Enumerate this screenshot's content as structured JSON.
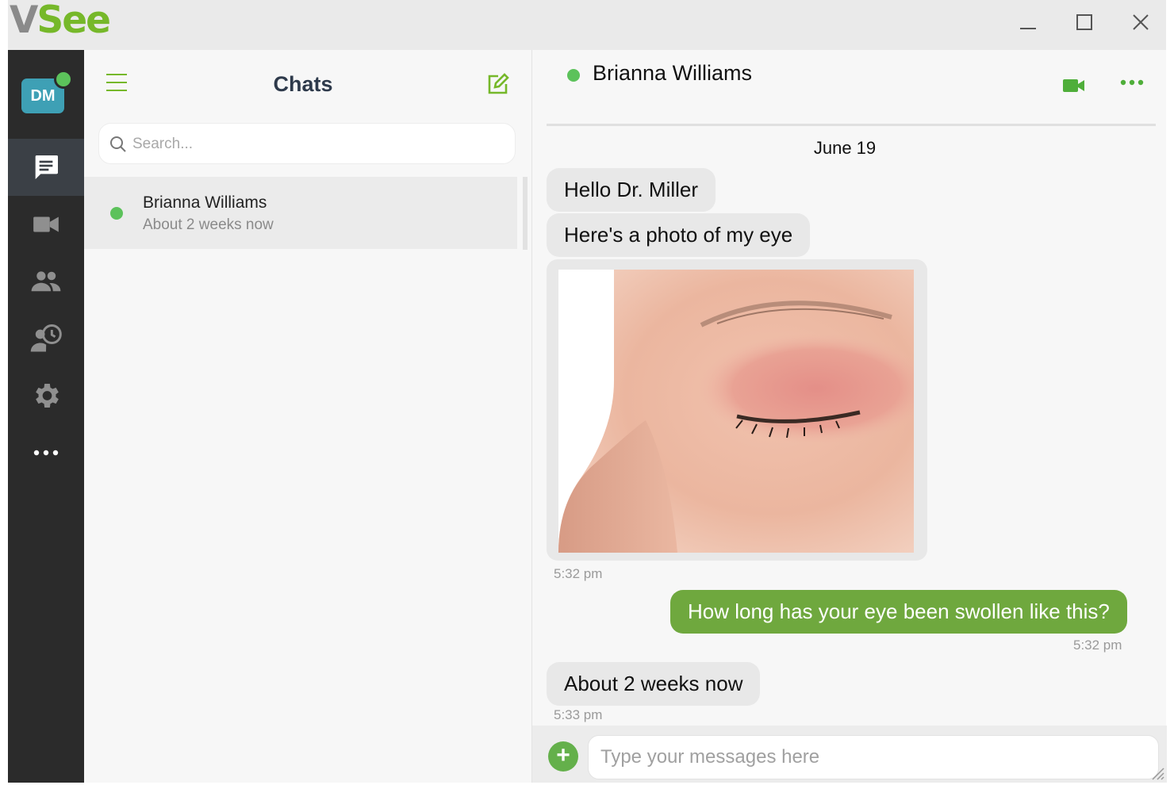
{
  "app": {
    "logo_first": "V",
    "logo_rest": "See",
    "brand_color": "#76b82a"
  },
  "window_controls": {
    "minimize_icon": "minimize-icon",
    "maximize_icon": "maximize-icon",
    "close_icon": "close-icon"
  },
  "nav": {
    "avatar_initials": "DM",
    "avatar_status": "online",
    "items": [
      {
        "icon": "chat-icon",
        "active": true
      },
      {
        "icon": "video-camera-icon",
        "active": false
      },
      {
        "icon": "contacts-icon",
        "active": false
      },
      {
        "icon": "history-icon",
        "active": false
      },
      {
        "icon": "gear-icon",
        "active": false
      },
      {
        "icon": "more-icon",
        "active": false
      }
    ]
  },
  "chat_list": {
    "title": "Chats",
    "search_placeholder": "Search...",
    "items": [
      {
        "name": "Brianna Williams",
        "preview": "About 2 weeks now",
        "status": "online"
      }
    ]
  },
  "conversation": {
    "contact_name": "Brianna Williams",
    "contact_status": "online",
    "date_separator": "June 19",
    "messages": [
      {
        "direction": "in",
        "text": "Hello Dr. Miller"
      },
      {
        "direction": "in",
        "text": "Here's a photo of my eye"
      },
      {
        "direction": "in",
        "type": "image",
        "image_desc": "close-up photo of a swollen eyelid",
        "time": "5:32 pm"
      },
      {
        "direction": "out",
        "text": "How long has your eye been swollen like this?",
        "time": "5:32 pm"
      },
      {
        "direction": "in",
        "text": "About 2 weeks now",
        "time": "5:33 pm"
      }
    ],
    "composer_placeholder": "Type your messages here",
    "add_label": "+"
  }
}
